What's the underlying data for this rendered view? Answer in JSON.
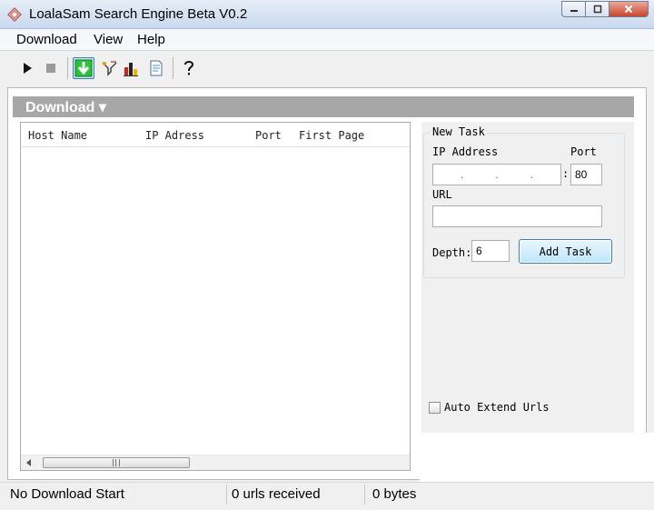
{
  "window": {
    "title": "LoalaSam Search Engine Beta V0.2",
    "icon": "app-diamond-icon"
  },
  "menu": {
    "items": [
      "Download",
      "View",
      "Help"
    ]
  },
  "toolbar": {
    "buttons": [
      {
        "name": "play-icon"
      },
      {
        "name": "stop-icon"
      },
      {
        "name": "download-arrow-icon",
        "active": true
      },
      {
        "name": "filter-icon"
      },
      {
        "name": "chart-icon"
      },
      {
        "name": "document-icon"
      },
      {
        "name": "help-icon"
      }
    ]
  },
  "section": {
    "title": "Download ▾"
  },
  "list": {
    "columns": [
      "Host Name",
      "IP Adress",
      "Port",
      "First Page"
    ],
    "rows": []
  },
  "new_task": {
    "title": "New Task",
    "ip_label": "IP Address",
    "ip_value": ". . .",
    "port_label": "Port",
    "port_value": "80",
    "colon": ":",
    "url_label": "URL",
    "url_value": "",
    "depth_label": "Depth:",
    "depth_value": "6",
    "add_task_label": "Add Task"
  },
  "options": {
    "auto_extend_label": "Auto Extend Urls",
    "auto_extend_checked": false
  },
  "status": {
    "message": "No Download Start",
    "urls": "0  urls received",
    "bytes": "0 bytes"
  },
  "colors": {
    "accent": "#3c7fb1",
    "section_bar": "#a7a7a7",
    "download_green": "#1fa22a"
  }
}
